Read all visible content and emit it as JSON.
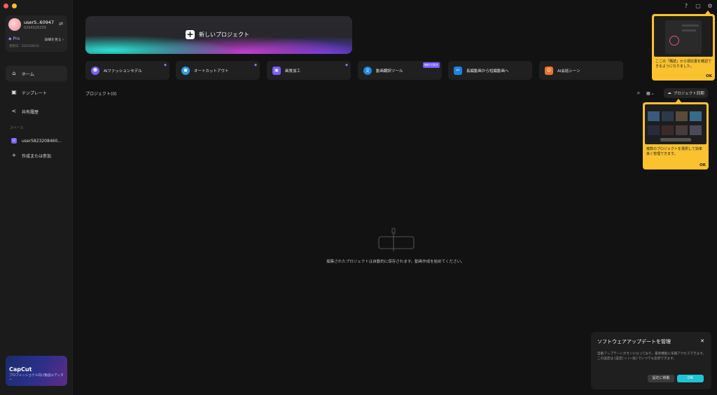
{
  "user": {
    "name": "userS..60947",
    "id": "0264026259",
    "plan": "Pro",
    "details_label": "詳細を見る",
    "expiry": "更新日：2025/08/16"
  },
  "sidebar": {
    "items": [
      {
        "label": "ホーム"
      },
      {
        "label": "テンプレート"
      },
      {
        "label": "共有履歴"
      }
    ],
    "space_title": "スペース",
    "space_item": {
      "badge": "U",
      "label": "user5823208460..."
    },
    "create_join": "作成または参加"
  },
  "promo": {
    "brand": "CapCut",
    "tagline": "プロフェッショナル向け動画エディター"
  },
  "hero": {
    "new_project": "新しいプロジェクト"
  },
  "tools": [
    {
      "label": "AIファッションモデル",
      "color": "#7a5cff",
      "icon": "shirt-icon"
    },
    {
      "label": "オートカットアウト",
      "color": "#2d9cdb",
      "icon": "person-icon"
    },
    {
      "label": "画質加工",
      "color": "#7a5cff",
      "icon": "image-icon"
    },
    {
      "label": "動画翻訳ツール",
      "color": "#1b84e0",
      "icon": "translate-icon",
      "tag": "無料で試す"
    },
    {
      "label": "長編動画から短編動画へ",
      "color": "#1b84e0",
      "icon": "scissors-icon"
    },
    {
      "label": "AI会話シーン",
      "color": "#e8742b",
      "icon": "chat-icon"
    }
  ],
  "projects": {
    "title": "プロジェクト(0)",
    "sync_label": "プロジェクト同期",
    "empty_message": "編集されたプロジェクトは自動的に保存されます。動画作成を始めてください。"
  },
  "tooltip1": {
    "text": "ここの「購読」から領収書を確認できるようになりました。",
    "ok": "OK"
  },
  "tooltip2": {
    "text": "複数のプロジェクトを選択して効率良く管理できます。",
    "ok": "OK"
  },
  "update_panel": {
    "title": "ソフトウェアアップデートを管理",
    "body": "自動アップデートがオンになっており、最新機能に早期アクセスできます。この設定は [設定] > [一般] でいつでも変更できます。",
    "goto_settings": "設定に移動",
    "ok": "OK"
  },
  "colors": {
    "accent": "#1ec6d3",
    "pro": "#7a5cff",
    "tooltip": "#f9c22e"
  }
}
